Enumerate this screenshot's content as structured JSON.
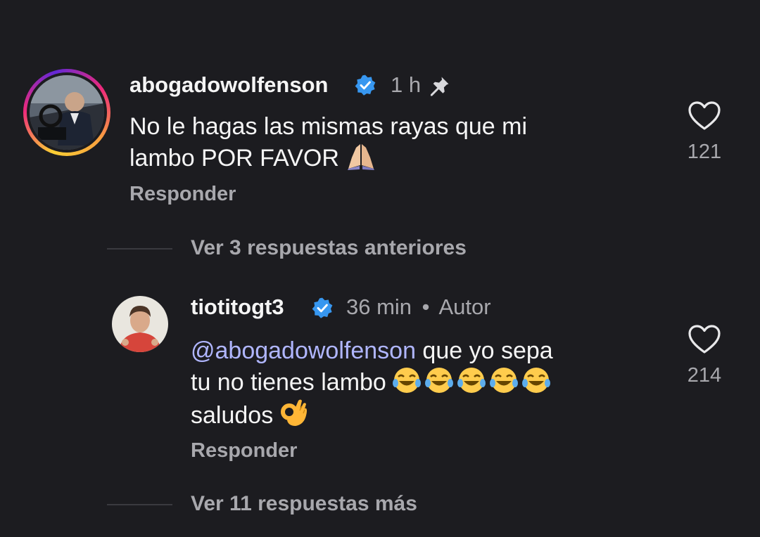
{
  "comments": [
    {
      "username": "abogadowolfenson",
      "time": "1 h",
      "text_line1": "No le hagas las mismas rayas que mi",
      "text_line2": "lambo POR FAVOR",
      "likes": "121",
      "reply_label": "Responder",
      "icons": [
        "verified-badge-icon",
        "pin-icon",
        "heart-icon",
        "praying-hands-emoji"
      ]
    },
    {
      "username": "tiotitogt3",
      "time": "36 min",
      "separator": "•",
      "role": "Autor",
      "mention": "@abogadowolfenson",
      "text_line1_rest": " que yo sepa",
      "text_line2": "tu no tienes lambo ",
      "text_line3": "saludos ",
      "likes": "214",
      "reply_label": "Responder",
      "icons": [
        "verified-badge-icon",
        "heart-icon",
        "laughing-crying-emoji",
        "ok-hand-emoji"
      ]
    }
  ],
  "view_previous": "Ver 3 respuestas anteriores",
  "view_more": "Ver 11 respuestas más",
  "colors": {
    "background": "#1c1c20",
    "text": "#f5f5f5",
    "muted": "#a8a8ad",
    "mention": "#b0b6ff",
    "verified": "#3797f0"
  }
}
